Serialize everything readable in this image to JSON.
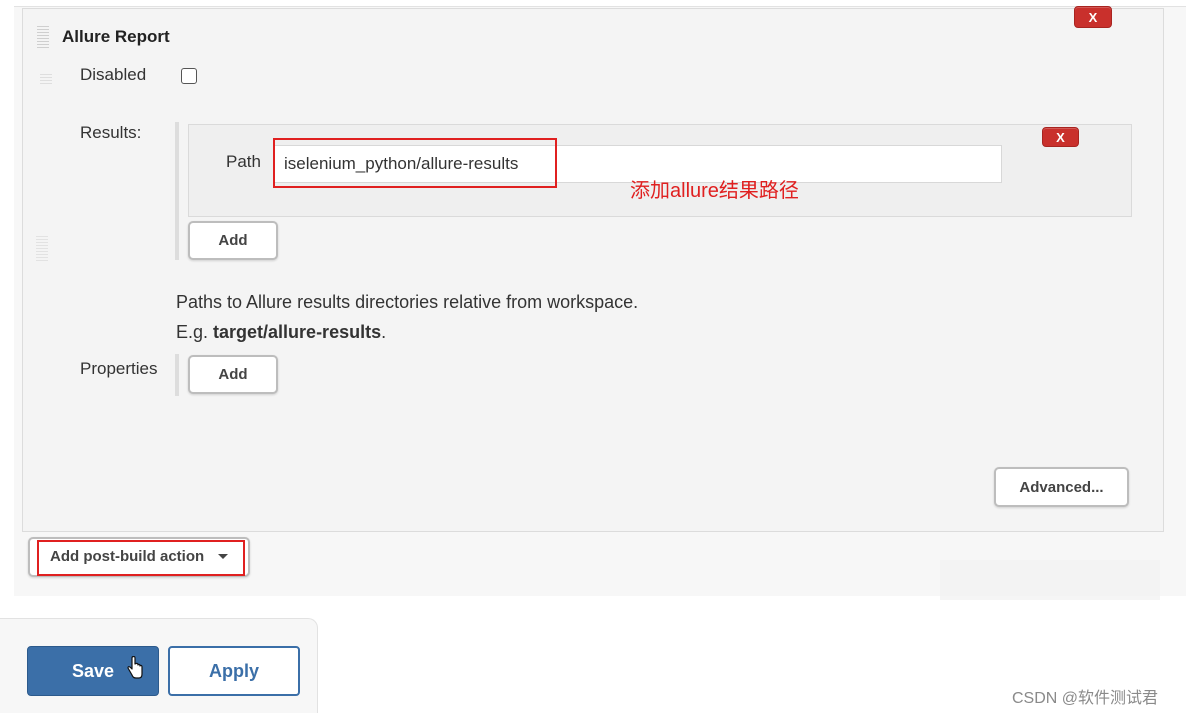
{
  "section": {
    "title": "Allure Report",
    "delete_label": "X"
  },
  "disabled": {
    "label": "Disabled",
    "checked": false
  },
  "results": {
    "label": "Results:",
    "path_label": "Path",
    "path_value": "iselenium_python/allure-results",
    "delete_label": "X",
    "add_label": "Add"
  },
  "annotation": "添加allure结果路径",
  "help": {
    "line1": "Paths to Allure results directories relative from workspace.",
    "line2_prefix": "E.g. ",
    "line2_bold": "target/allure-results",
    "line2_suffix": "."
  },
  "properties": {
    "label": "Properties",
    "add_label": "Add"
  },
  "advanced_label": "Advanced...",
  "post_build": {
    "label": "Add post-build action"
  },
  "footer": {
    "save_label": "Save",
    "apply_label": "Apply"
  },
  "watermark": "CSDN @软件测试君",
  "colors": {
    "accent": "#3b6fa8",
    "delete": "#c9302c",
    "highlight": "#e02020"
  }
}
